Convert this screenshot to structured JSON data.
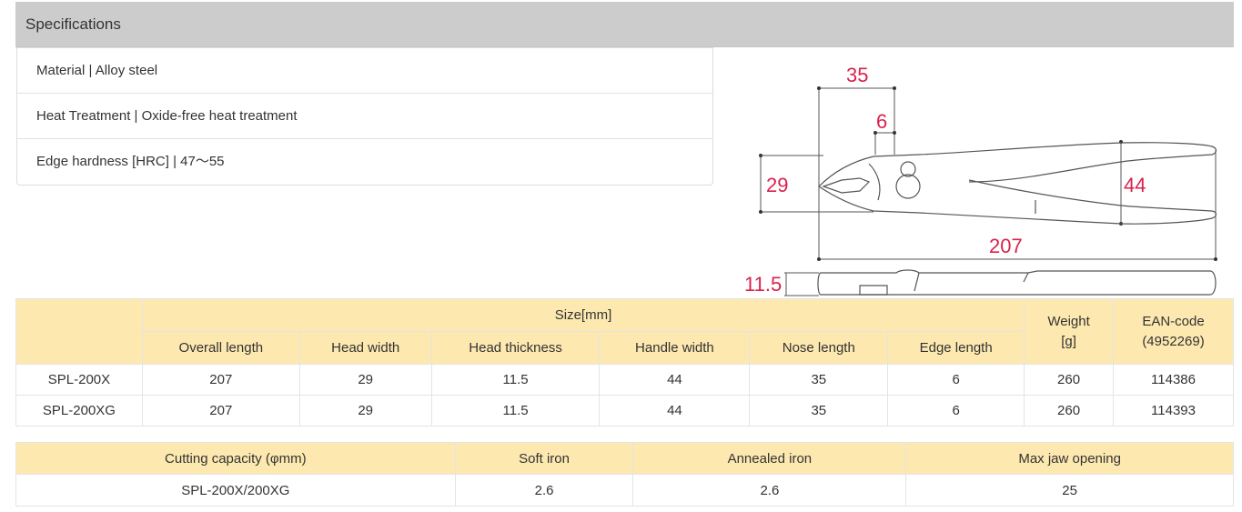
{
  "section_title": "Specifications",
  "specs": [
    "Material | Alloy steel",
    "Heat Treatment | Oxide-free heat treatment",
    "Edge hardness [HRC] | 47～55"
  ],
  "diagram": {
    "nose_length": "35",
    "edge_length": "6",
    "head_width": "29",
    "handle_width": "44",
    "overall_length": "207",
    "head_thickness": "11.5",
    "dimension_color": "#d9224c"
  },
  "size_table": {
    "group_header": "Size[mm]",
    "columns": [
      "Overall length",
      "Head width",
      "Head thickness",
      "Handle width",
      "Nose length",
      "Edge length"
    ],
    "weight_header_line1": "Weight",
    "weight_header_line2": "[g]",
    "ean_header_line1": "EAN-code",
    "ean_header_line2": "(4952269)",
    "rows": [
      [
        "SPL-200X",
        "207",
        "29",
        "11.5",
        "44",
        "35",
        "6",
        "260",
        "114386"
      ],
      [
        "SPL-200XG",
        "207",
        "29",
        "11.5",
        "44",
        "35",
        "6",
        "260",
        "114393"
      ]
    ]
  },
  "cutting_table": {
    "columns": [
      "Cutting capacity (φmm)",
      "Soft iron",
      "Annealed iron",
      "Max jaw opening"
    ],
    "rows": [
      [
        "SPL-200X/200XG",
        "2.6",
        "2.6",
        "25"
      ]
    ]
  },
  "colors": {
    "header_bg": "#cccccc",
    "table_header_bg": "#fde9b0"
  }
}
